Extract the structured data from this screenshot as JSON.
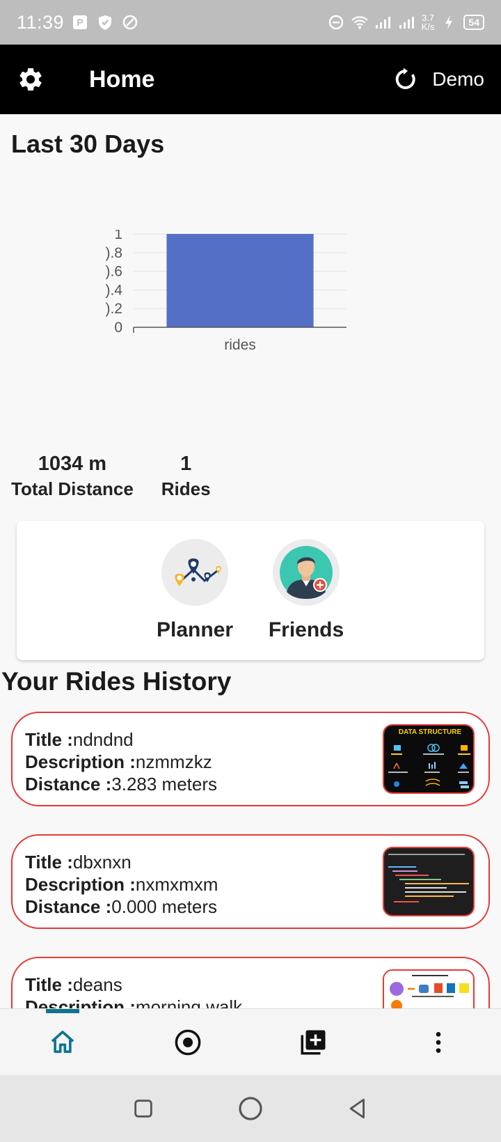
{
  "status_bar": {
    "time": "11:39",
    "net_speed_value": "3.7",
    "net_speed_unit": "K/s",
    "battery": "54"
  },
  "app_bar": {
    "title": "Home",
    "demo_label": "Demo"
  },
  "summary": {
    "title": "Last 30 Days",
    "total_distance_value": "1034 m",
    "total_distance_label": "Total Distance",
    "rides_value": "1",
    "rides_label": "Rides"
  },
  "chart_data": {
    "type": "bar",
    "categories": [
      "rides"
    ],
    "values": [
      1
    ],
    "ylim": [
      0,
      1
    ],
    "yticks": [
      "0",
      ").2",
      ").4",
      ").6",
      ").8",
      "1"
    ],
    "grid": true,
    "bar_color": "#5470c6"
  },
  "actions": {
    "planner_label": "Planner",
    "friends_label": "Friends"
  },
  "history": {
    "title": "Your Rides History",
    "title_key": "Title :",
    "description_key": "Description :",
    "distance_key": "Distance :",
    "rides": [
      {
        "title": "ndndnd",
        "description": "nzmmzkz",
        "distance": "3.283 meters",
        "thumb_heading": "DATA STRUCTURE"
      },
      {
        "title": "dbxnxn",
        "description": "nxmxmxm",
        "distance": "0.000 meters"
      },
      {
        "title": "deans",
        "description": "morning walk"
      }
    ]
  },
  "colors": {
    "app_bar": "#000000",
    "card_border": "#e53935",
    "nav_active": "#0e7490",
    "bar": "#5470c6"
  },
  "bottom_nav": {
    "items": [
      "home-icon",
      "record-icon",
      "add-ride-icon",
      "more-icon"
    ],
    "active_index": 0
  }
}
